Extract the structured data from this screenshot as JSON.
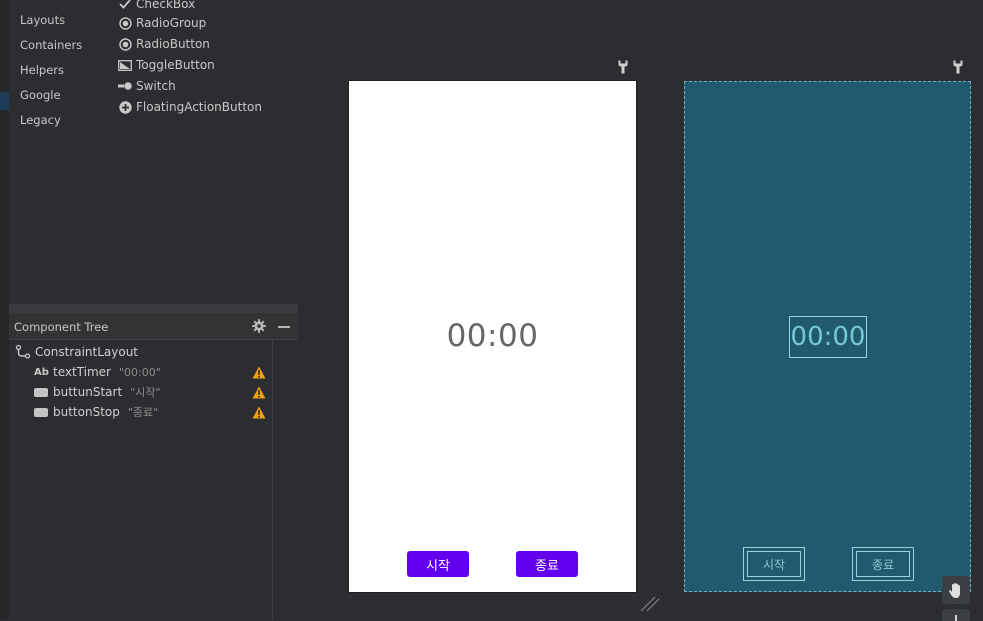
{
  "palette": {
    "categories": [
      "Layouts",
      "Containers",
      "Helpers",
      "Google",
      "Legacy"
    ],
    "components": [
      {
        "label": "CheckBox",
        "icon": "check-icon"
      },
      {
        "label": "RadioGroup",
        "icon": "radio-icon"
      },
      {
        "label": "RadioButton",
        "icon": "radio-icon"
      },
      {
        "label": "ToggleButton",
        "icon": "toggle-icon"
      },
      {
        "label": "Switch",
        "icon": "switch-icon"
      },
      {
        "label": "FloatingActionButton",
        "icon": "plus-circle-icon"
      }
    ]
  },
  "tree": {
    "title": "Component Tree",
    "root": "ConstraintLayout",
    "nodes": [
      {
        "id": "textTimer",
        "text": "\"00:00\"",
        "icon": "ab-icon",
        "warning": true
      },
      {
        "id": "buttunStart",
        "text": "\"시작\"",
        "icon": "button-icon",
        "warning": true
      },
      {
        "id": "buttonStop",
        "text": "\"종료\"",
        "icon": "button-icon",
        "warning": true
      }
    ]
  },
  "design": {
    "timer": "00:00",
    "start_label": "시작",
    "stop_label": "종료"
  },
  "blueprint": {
    "timer": "00:00",
    "start_label": "시작",
    "stop_label": "종료"
  },
  "colors": {
    "button_purple": "#6200ee",
    "blueprint_bg": "#225a6d",
    "warning": "#f0a30a"
  }
}
